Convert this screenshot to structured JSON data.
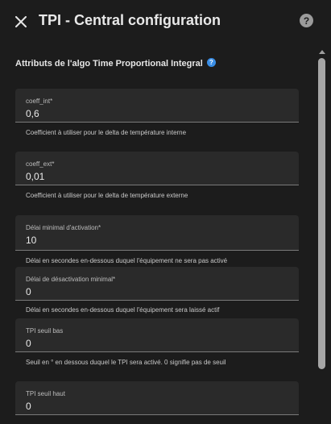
{
  "header": {
    "title": "TPI - Central configuration",
    "help_glyph": "?",
    "close_icon": "close-icon",
    "help_icon": "help-circle-icon"
  },
  "section": {
    "title": "Attributs de l'algo Time Proportional Integral",
    "info_glyph": "?",
    "info_icon": "info-circle-icon"
  },
  "fields": [
    {
      "label": "coeff_int*",
      "value": "0,6",
      "helper": "Coefficient à utiliser pour le delta de température interne"
    },
    {
      "label": "coeff_ext*",
      "value": "0,01",
      "helper": "Coefficient à utiliser pour le delta de température externe"
    },
    {
      "label": "Délai minimal d'activation*",
      "value": "10",
      "helper": "Délai en secondes en-dessous duquel l'équipement ne sera pas activé"
    },
    {
      "label": "Délai de désactivation minimal*",
      "value": "0",
      "helper": "Délai en secondes en-dessous duquel l'équipement sera laissé actif"
    },
    {
      "label": "TPI seuil bas",
      "value": "0",
      "helper": "Seuil en ° en dessous duquel le TPI sera activé. 0 signifie pas de seuil"
    },
    {
      "label": "TPI seuil haut",
      "value": "0",
      "helper": ""
    }
  ],
  "colors": {
    "background": "#1c1c1c",
    "field_background": "#2a2a2a",
    "info_accent": "#3a8ee6",
    "scrollbar": "#a6a6a6"
  }
}
